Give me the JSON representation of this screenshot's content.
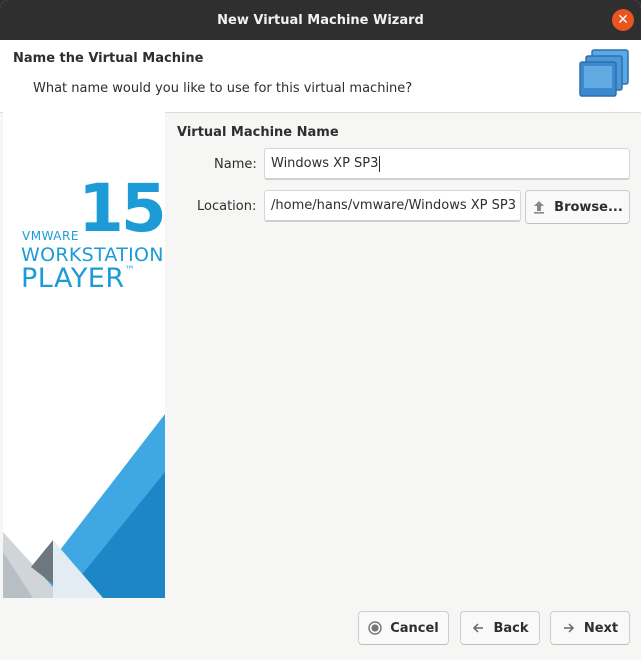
{
  "window": {
    "title": "New Virtual Machine Wizard"
  },
  "header": {
    "title": "Name the Virtual Machine",
    "subtitle": "What name would you like to use for this virtual machine?"
  },
  "branding": {
    "vendor": "VMWARE",
    "version": "15",
    "product_line1": "WORKSTATION",
    "product_line2": "PLAYER",
    "trademark": "™",
    "accent_color": "#1d9bd7"
  },
  "form": {
    "section_title": "Virtual Machine Name",
    "name_label": "Name:",
    "name_value": "Windows XP SP3",
    "location_label": "Location:",
    "location_value": "/home/hans/vmware/Windows XP SP3",
    "browse_label": "Browse...",
    "browse_icon": "upload-arrow-icon"
  },
  "footer": {
    "cancel_label": "Cancel",
    "cancel_icon": "stop-circle-icon",
    "back_label": "Back",
    "back_icon": "arrow-left-icon",
    "next_label": "Next",
    "next_icon": "arrow-right-icon"
  },
  "colors": {
    "titlebar": "#2f2f2f",
    "close_button": "#e9541f"
  }
}
